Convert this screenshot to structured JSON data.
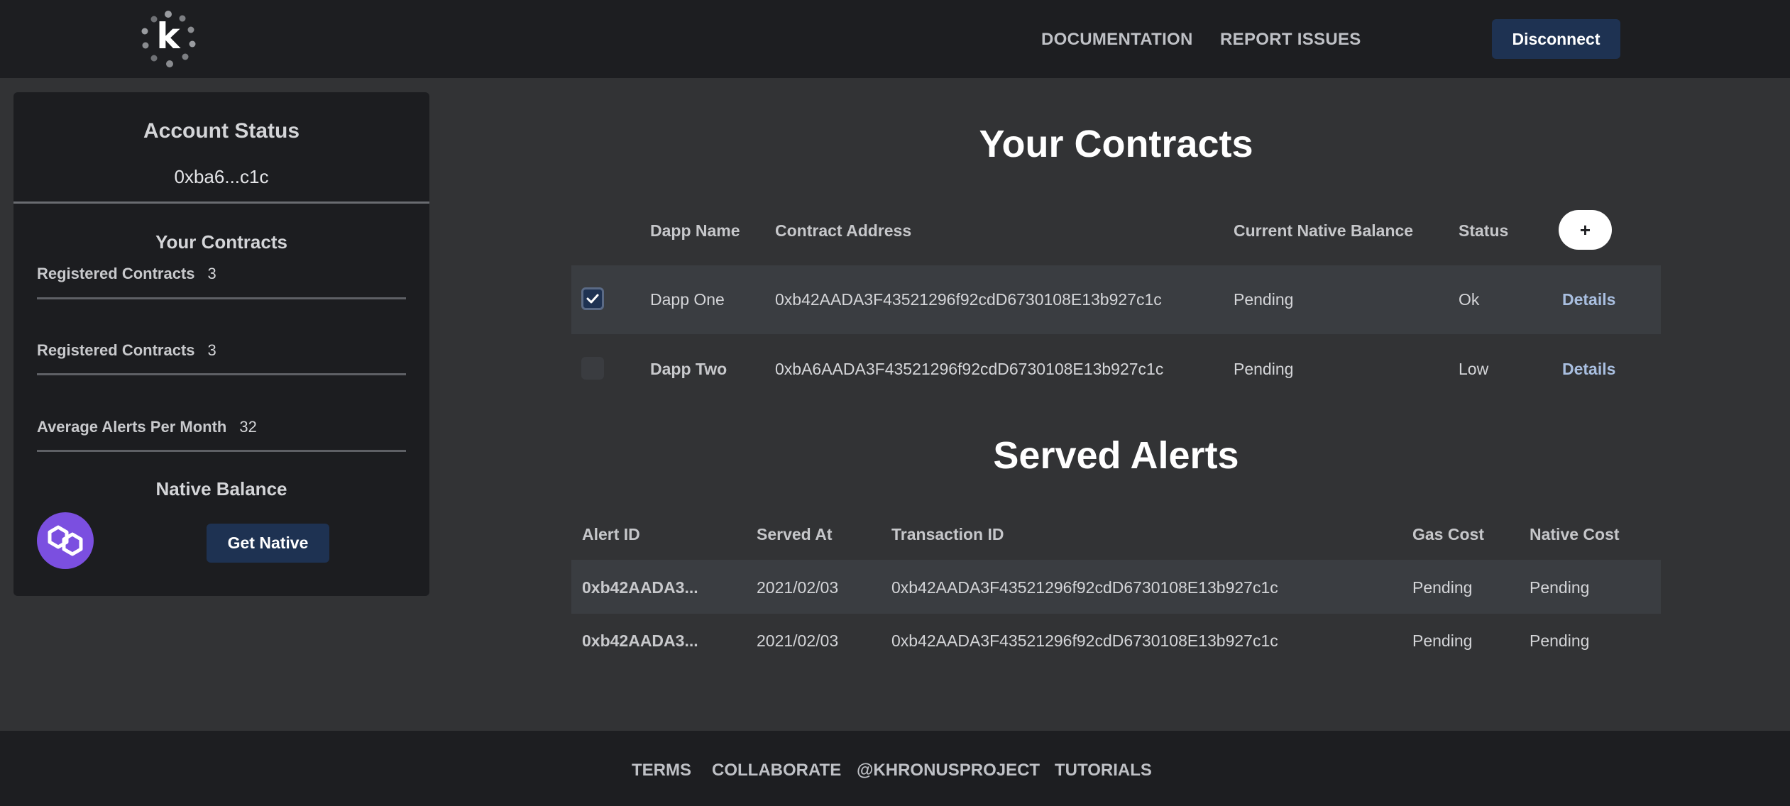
{
  "header": {
    "logo_letter": "k",
    "nav": {
      "documentation": "DOCUMENTATION",
      "report_issues": "REPORT ISSUES"
    },
    "disconnect_label": "Disconnect"
  },
  "sidebar": {
    "account_status_title": "Account Status",
    "address": "0xba6...c1c",
    "your_contracts_title": "Your Contracts",
    "stats": [
      {
        "label": "Registered Contracts",
        "value": "3"
      },
      {
        "label": "Registered Contracts",
        "value": "3"
      },
      {
        "label": "Average Alerts Per Month",
        "value": "32"
      }
    ],
    "native_balance_title": "Native Balance",
    "token_icon": "polygon-icon",
    "get_native_label": "Get Native"
  },
  "contracts": {
    "title": "Your Contracts",
    "columns": [
      "Dapp Name",
      "Contract Address",
      "Current Native Balance",
      "Status"
    ],
    "add_label": "+",
    "rows": [
      {
        "checked": true,
        "name": "Dapp One",
        "address": "0xb42AADA3F43521296f92cdD6730108E13b927c1c",
        "balance": "Pending",
        "status": "Ok",
        "action": "Details"
      },
      {
        "checked": false,
        "name": "Dapp Two",
        "address": "0xbA6AADA3F43521296f92cdD6730108E13b927c1c",
        "balance": "Pending",
        "status": "Low",
        "action": "Details"
      }
    ]
  },
  "alerts": {
    "title": "Served Alerts",
    "columns": [
      "Alert ID",
      "Served At",
      "Transaction ID",
      "Gas Cost",
      "Native Cost"
    ],
    "rows": [
      {
        "alert_id": "0xb42AADA3...",
        "served_at": "2021/02/03",
        "tx_id": "0xb42AADA3F43521296f92cdD6730108E13b927c1c",
        "gas": "Pending",
        "native": "Pending"
      },
      {
        "alert_id": "0xb42AADA3...",
        "served_at": "2021/02/03",
        "tx_id": "0xb42AADA3F43521296f92cdD6730108E13b927c1c",
        "gas": "Pending",
        "native": "Pending"
      }
    ]
  },
  "footer": {
    "links": [
      "TERMS",
      "COLLABORATE",
      "@KHRONUSPROJECT",
      "TUTORIALS"
    ]
  },
  "colors": {
    "background": "#323335",
    "header": "#1d1e21",
    "button": "#1e3252",
    "accent_link": "#a9bfe0",
    "polygon": "#7b4fe0"
  }
}
